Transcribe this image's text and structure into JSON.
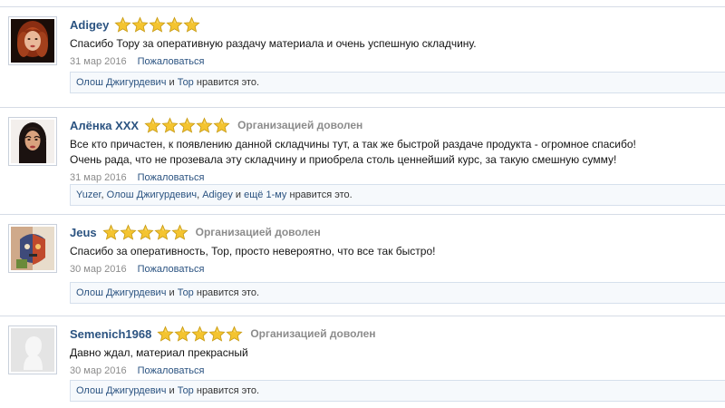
{
  "theme": {
    "link_color": "#2b5381",
    "muted_color": "#8c8c8c",
    "star_color": "#f4c430",
    "likes_bg": "#f6f9fc"
  },
  "reviews": [
    {
      "username": "Adigey",
      "stars": 5,
      "rating_label": "",
      "message": [
        "Спасибо Тору за оперативную раздачу материала и очень успешную складчину."
      ],
      "date": "31 мар 2016",
      "report": "Пожаловаться",
      "likers": [
        "Олош Джигурдевич",
        "Тор"
      ],
      "likes_connector": " и ",
      "likes_more": "",
      "likes_suffix": " нравится это.",
      "avatar_icon": "redhead-woman-avatar"
    },
    {
      "username": "Алёнка ХХХ",
      "stars": 5,
      "rating_label": "Организацией доволен",
      "message": [
        "Все кто причастен, к появлению данной складчины тут, а так же быстрой раздаче продукта - огромное спасибо!",
        "Очень рада, что не прозевала эту складчину и приобрела столь ценнейший курс, за такую смешную сумму!"
      ],
      "date": "31 мар 2016",
      "report": "Пожаловаться",
      "likers": [
        "Yuzer",
        "Олош Джигурдевич",
        "Adigey"
      ],
      "likes_connector": ", ",
      "likes_more": "ещё 1-му",
      "likes_suffix": " нравится это.",
      "avatar_icon": "brunette-woman-avatar"
    },
    {
      "username": "Jeus",
      "stars": 5,
      "rating_label": "Организацией доволен",
      "message": [
        "Спасибо за оперативность, Тор, просто невероятно, что все так быстро!"
      ],
      "date": "30 мар 2016",
      "report": "Пожаловаться",
      "likers": [
        "Олош Джигурдевич",
        "Тор"
      ],
      "likes_connector": " и ",
      "likes_more": "",
      "likes_suffix": " нравится это.",
      "avatar_icon": "abstract-face-avatar"
    },
    {
      "username": "Semenich1968",
      "stars": 5,
      "rating_label": "Организацией доволен",
      "message": [
        "Давно ждал, материал прекрасный"
      ],
      "date": "30 мар 2016",
      "report": "Пожаловаться",
      "likers": [
        "Олош Джигурдевич",
        "Тор"
      ],
      "likes_connector": " и ",
      "likes_more": "",
      "likes_suffix": " нравится это.",
      "avatar_icon": "default-silhouette-avatar"
    }
  ]
}
